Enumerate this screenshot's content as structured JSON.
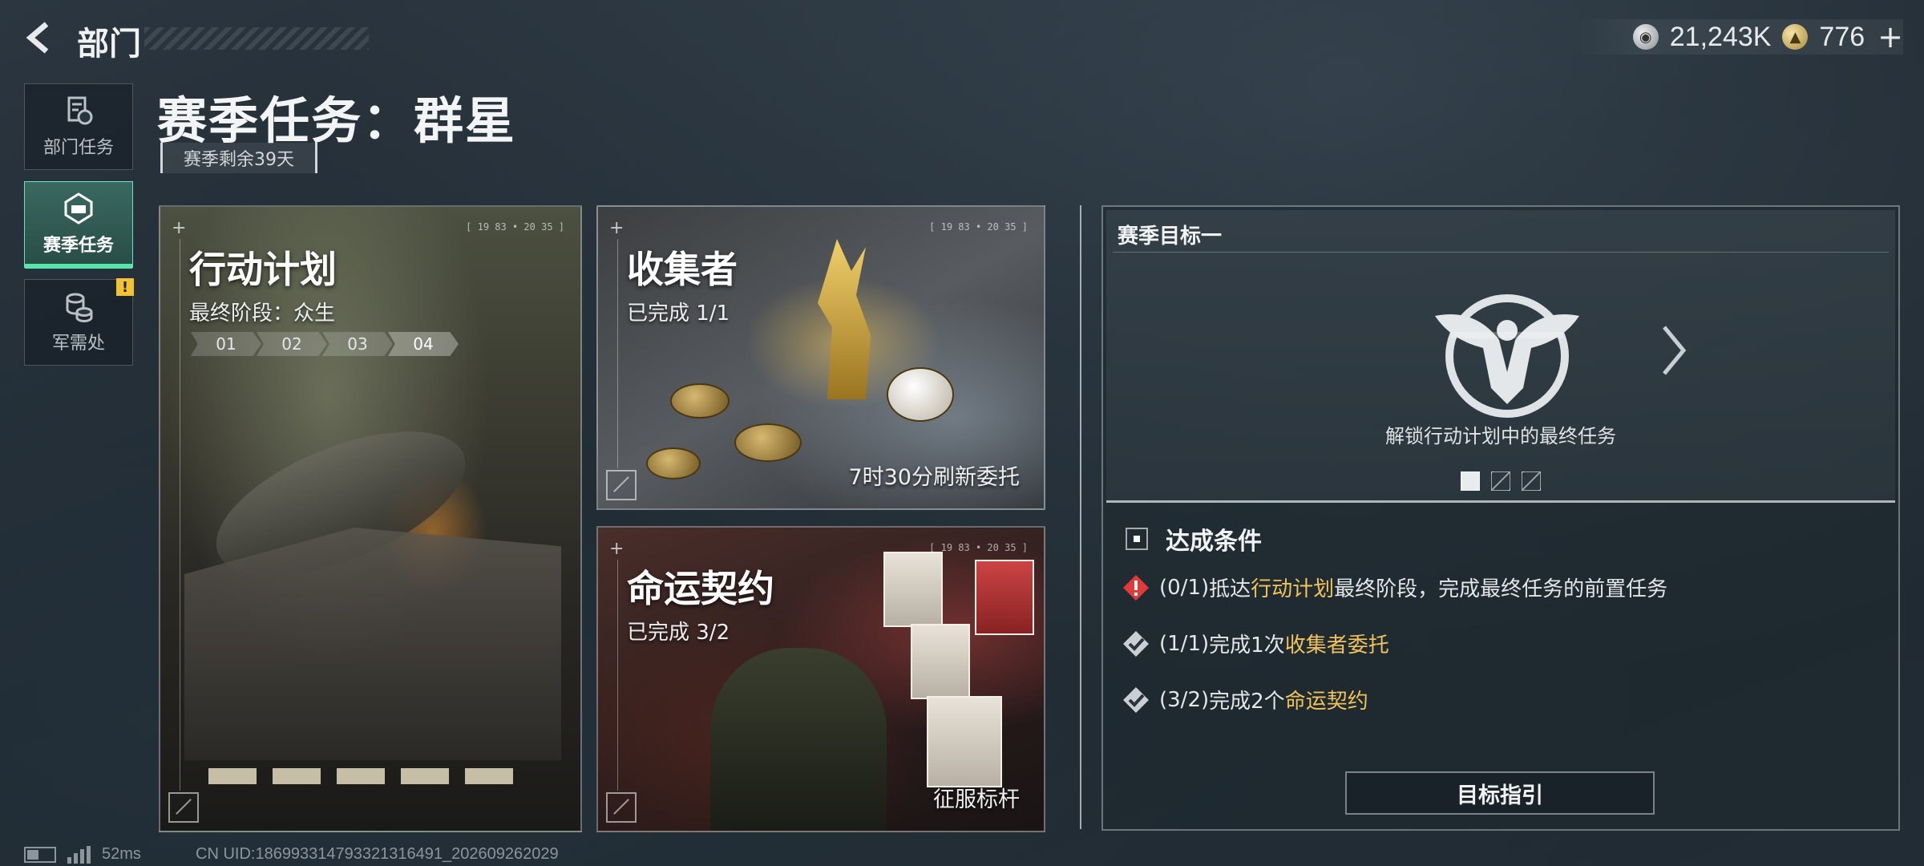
{
  "header": {
    "back_icon": "back-arrow-icon",
    "title": "部门"
  },
  "currency": [
    {
      "icon": "silver-coin-icon",
      "value": "21,243K"
    },
    {
      "icon": "gold-coin-icon",
      "value": "776"
    }
  ],
  "currency_plus": "+",
  "sidebar": {
    "items": [
      {
        "label": "部门任务",
        "icon": "task-list-icon",
        "active": false
      },
      {
        "label": "赛季任务",
        "icon": "season-badge-icon",
        "active": true
      },
      {
        "label": "军需处",
        "icon": "coin-stack-icon",
        "active": false,
        "badge": "!"
      }
    ]
  },
  "page": {
    "title": "赛季任务：群星",
    "season_remaining": "赛季剩余39天"
  },
  "cards": {
    "plan": {
      "title": "行动计划",
      "subtitle": "最终阶段：众生",
      "stages": [
        "01",
        "02",
        "03",
        "04"
      ],
      "current_stage": 4,
      "hud": "[ 19 83 • 20 35 ]"
    },
    "collector": {
      "title": "收集者",
      "subtitle": "已完成 1/1",
      "footer": "7时30分刷新委托",
      "hud": "[ 19 83 • 20 35 ]"
    },
    "fate": {
      "title": "命运契约",
      "subtitle": "已完成 3/2",
      "footer": "征服标杆",
      "hud": "[ 19 83 • 20 35 ]"
    }
  },
  "target": {
    "title": "赛季目标一",
    "emblem": "eagle-emblem-icon",
    "description": "解锁行动计划中的最终任务",
    "pages": 3,
    "current_page": 1,
    "conditions_title": "达成条件",
    "conditions": [
      {
        "status": "warning",
        "progress": "(0/1)",
        "pre": "抵达",
        "highlight": "行动计划",
        "post": "最终阶段，完成最终任务的前置任务"
      },
      {
        "status": "done",
        "progress": "(1/1)",
        "pre": "完成1次",
        "highlight": "收集者委托",
        "post": ""
      },
      {
        "status": "done",
        "progress": "(3/2)",
        "pre": "完成2个",
        "highlight": "命运契约",
        "post": ""
      }
    ],
    "guide_button": "目标指引"
  },
  "status_bar": {
    "ping": "52ms",
    "uid": "CN UID:18699331479332131649​1_202609262029"
  },
  "colors": {
    "accent": "#55e6a8",
    "highlight": "#f1c35a",
    "warning": "#e23a3a"
  }
}
